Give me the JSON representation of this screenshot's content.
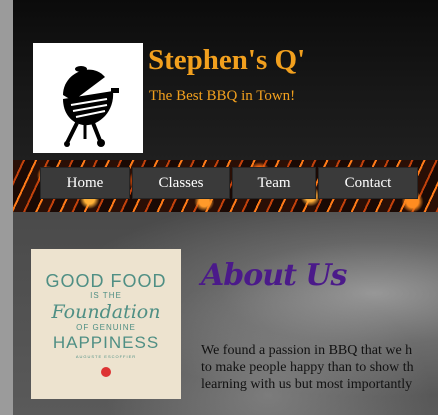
{
  "header": {
    "logo": {
      "icon": "bbq-grill-icon"
    },
    "title": "Stephen's Q'",
    "tagline": "The Best BBQ in Town!"
  },
  "nav": {
    "items": [
      {
        "label": "Home"
      },
      {
        "label": "Classes"
      },
      {
        "label": "Team"
      },
      {
        "label": "Contact"
      }
    ]
  },
  "about": {
    "heading": "About Us",
    "image_text": {
      "line1": "GOOD FOOD",
      "line2": "IS THE",
      "line3": "Foundation",
      "line4": "OF GENUINE",
      "line5": "HAPPINESS",
      "line6": "AUGUSTE ESCOFFIER"
    },
    "paragraph_lines": [
      "We found a passion in BBQ that we h",
      "to make people happy than to show th",
      "learning with us but most importantly"
    ]
  },
  "colors": {
    "title": "#f2a01e",
    "heading": "#4b1a8a",
    "nav_button": "#3a3a3a"
  }
}
